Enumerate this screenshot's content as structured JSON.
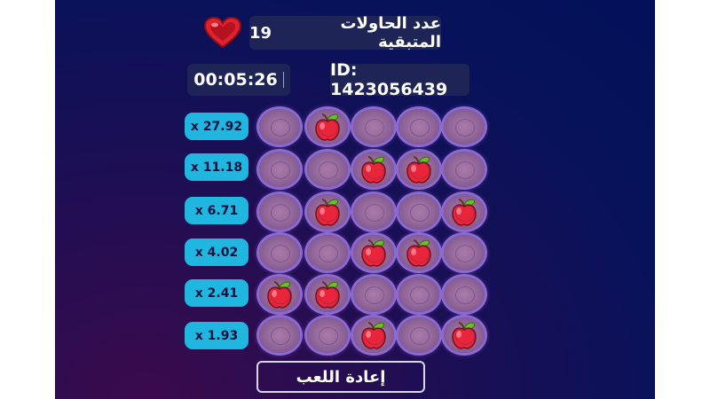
{
  "header": {
    "attempts_label": "عدد الحاولات المتبقية",
    "attempts_count": "19",
    "timer": "00:05:26",
    "game_id": "ID: 1423056439"
  },
  "multipliers": [
    "x 27.92",
    "x 11.18",
    "x 6.71",
    "x 4.02",
    "x 2.41",
    "x 1.93"
  ],
  "board": {
    "rows": 6,
    "columns": 5,
    "apples": [
      [
        0,
        1,
        0,
        0,
        0
      ],
      [
        0,
        0,
        1,
        1,
        0
      ],
      [
        0,
        1,
        0,
        0,
        1
      ],
      [
        0,
        0,
        1,
        1,
        0
      ],
      [
        1,
        1,
        0,
        0,
        0
      ],
      [
        0,
        0,
        1,
        0,
        1
      ]
    ]
  },
  "replay_button": {
    "label": "إعادة اللعب"
  },
  "colors": {
    "background": "#07125a",
    "pill": "#1f2457",
    "multiplier": "#1fb7e0",
    "tile_glow": "#8c6ad1",
    "apple": "#e8253a",
    "heart": "#e0222e"
  },
  "icons": {
    "heart": "heart-icon",
    "apple": "apple-icon"
  }
}
